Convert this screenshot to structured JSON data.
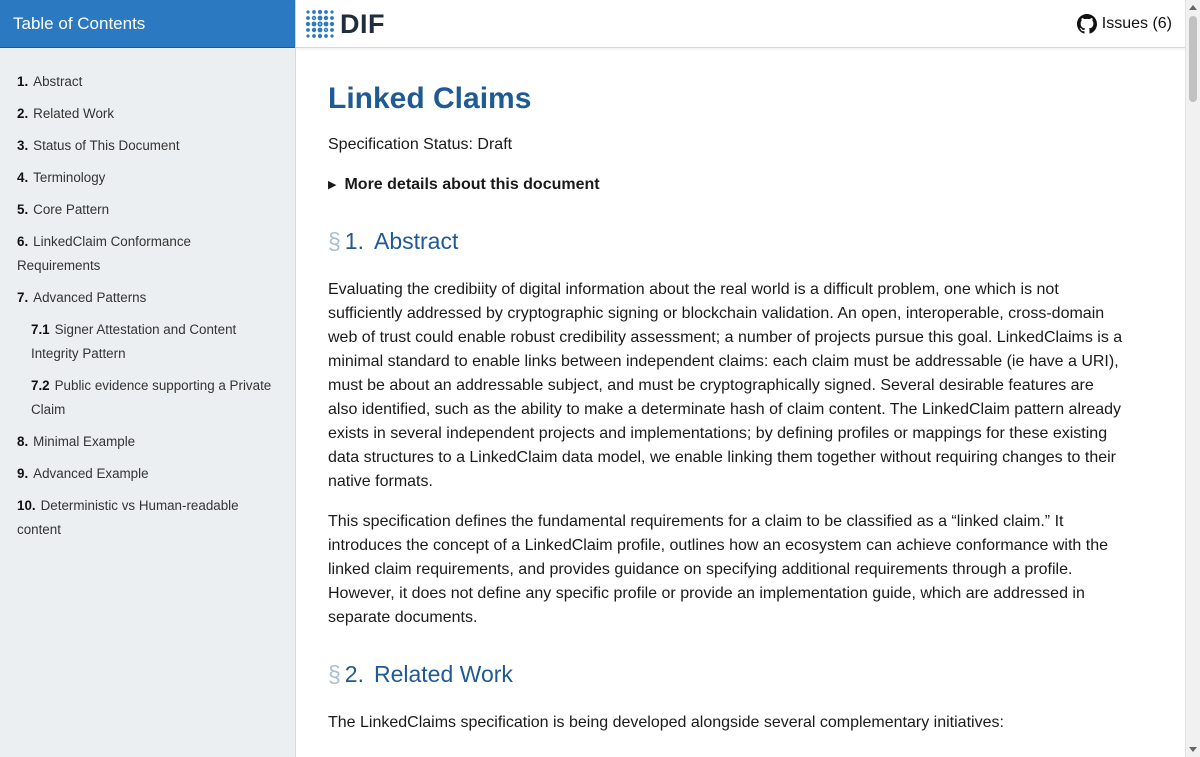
{
  "sidebar": {
    "title": "Table of Contents",
    "items": [
      {
        "num": "1.",
        "label": "Abstract"
      },
      {
        "num": "2.",
        "label": "Related Work"
      },
      {
        "num": "3.",
        "label": "Status of This Document"
      },
      {
        "num": "4.",
        "label": "Terminology"
      },
      {
        "num": "5.",
        "label": "Core Pattern"
      },
      {
        "num": "6.",
        "label": "LinkedClaim Conformance Requirements"
      },
      {
        "num": "7.",
        "label": "Advanced Patterns"
      },
      {
        "num": "7.1",
        "label": "Signer Attestation and Content Integrity Pattern"
      },
      {
        "num": "7.2",
        "label": "Public evidence supporting a Private Claim"
      },
      {
        "num": "8.",
        "label": "Minimal Example"
      },
      {
        "num": "9.",
        "label": "Advanced Example"
      },
      {
        "num": "10.",
        "label": "Deterministic vs Human-readable content"
      }
    ]
  },
  "header": {
    "logo_text": "DIF",
    "issues_label": "Issues (6)"
  },
  "doc": {
    "title": "Linked Claims",
    "status": "Specification Status: Draft",
    "details_toggle": "More details about this document",
    "section_symbol": "§",
    "sections": [
      {
        "num": "1.",
        "title": "Abstract",
        "paragraphs": [
          "Evaluating the credibiity of digital information about the real world is a difficult problem, one which is not sufficiently addressed by cryptographic signing or blockchain validation. An open, interoperable, cross-domain web of trust could enable robust credibility assessment; a number of projects pursue this goal. LinkedClaims is a minimal standard to enable links between independent claims: each claim must be addressable (ie have a URI), must be about an addressable subject, and must be cryptographically signed. Several desirable features are also identified, such as the ability to make a determinate hash of claim content. The LinkedClaim pattern already exists in several independent projects and implementations; by defining profiles or mappings for these existing data structures to a LinkedClaim data model, we enable linking them together without requiring changes to their native formats.",
          "This specification defines the fundamental requirements for a claim to be classified as a “linked claim.” It introduces the concept of a LinkedClaim profile, outlines how an ecosystem can achieve conformance with the linked claim requirements, and provides guidance on specifying additional requirements through a profile. However, it does not define any specific profile or provide an implementation guide, which are addressed in separate documents."
        ]
      },
      {
        "num": "2.",
        "title": "Related Work",
        "paragraphs": [
          "The LinkedClaims specification is being developed alongside several complementary initiatives:"
        ]
      }
    ]
  },
  "colors": {
    "sidebar_header": "#2a79c1",
    "sidebar_bg": "#eceff2",
    "heading": "#1f5a94",
    "section_symbol": "#a6bfd6"
  },
  "icons": {
    "logo": "dif-dots-logo",
    "issues": "github-icon",
    "details": "triangle-right-icon"
  }
}
